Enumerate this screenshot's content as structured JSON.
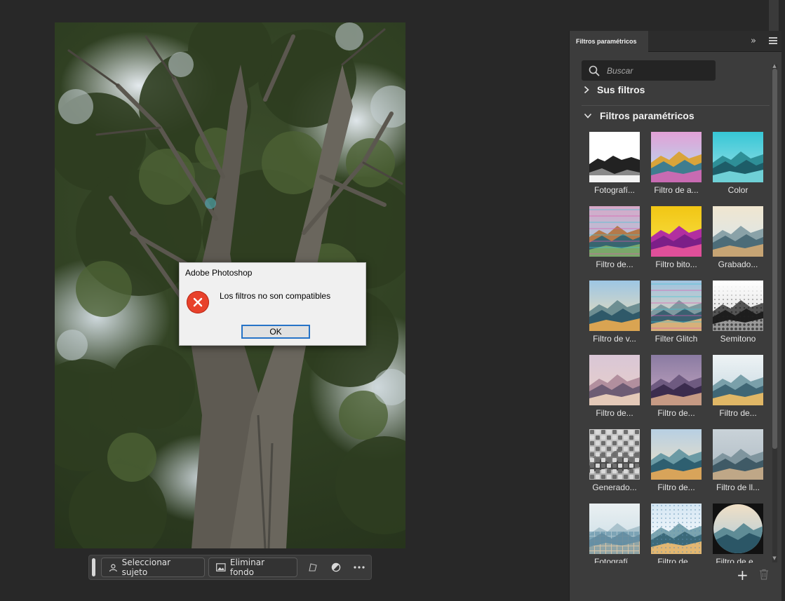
{
  "panel": {
    "tab_title": "Filtros paramétricos",
    "search": {
      "placeholder": "Buscar",
      "value": ""
    },
    "sections": {
      "your_filters": "Sus filtros",
      "parametric": "Filtros paramétricos"
    },
    "filters": [
      {
        "label": "Fotografí...",
        "style": "bw"
      },
      {
        "label": "Filtro de a...",
        "style": "rainbow"
      },
      {
        "label": "Color",
        "style": "cyan"
      },
      {
        "label": "Filtro de...",
        "style": "glitch"
      },
      {
        "label": "Filtro bito...",
        "style": "yellow"
      },
      {
        "label": "Grabado...",
        "style": "pale"
      },
      {
        "label": "Filtro de v...",
        "style": "warm"
      },
      {
        "label": "Filter Glitch",
        "style": "glitch2"
      },
      {
        "label": "Semitono",
        "style": "halftone"
      },
      {
        "label": "Filtro de...",
        "style": "pink"
      },
      {
        "label": "Filtro de...",
        "style": "purple"
      },
      {
        "label": "Filtro de...",
        "style": "paint"
      },
      {
        "label": "Generado...",
        "style": "pattern"
      },
      {
        "label": "Filtro de...",
        "style": "natural"
      },
      {
        "label": "Filtro de ll...",
        "style": "gray"
      },
      {
        "label": "Fotografí...",
        "style": "tiles"
      },
      {
        "label": "Filtro de...",
        "style": "pointil"
      },
      {
        "label": "Filtro de e...",
        "style": "sphere"
      }
    ]
  },
  "dialog": {
    "title": "Adobe Photoshop",
    "message": "Los filtros no son compatibles",
    "ok_label": "OK"
  },
  "taskbar": {
    "select_subject": "Seleccionar sujeto",
    "remove_background": "Eliminar fondo"
  },
  "colors": {
    "app_background": "#282828",
    "panel_background": "#3c3c3c",
    "error_red": "#e8412b",
    "ok_focus_border": "#2673c7"
  }
}
